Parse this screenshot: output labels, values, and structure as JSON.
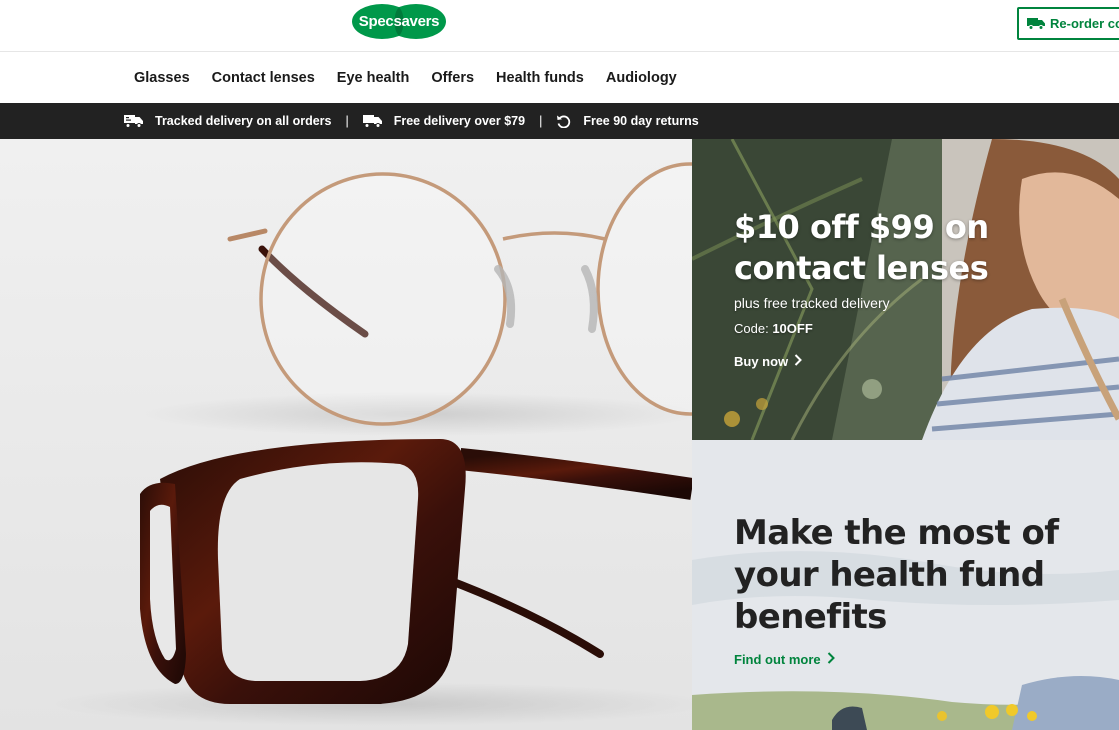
{
  "header": {
    "logo_text": "Specsavers",
    "reorder_label": "Re-order contacts"
  },
  "nav": {
    "items": [
      {
        "label": "Glasses"
      },
      {
        "label": "Contact lenses"
      },
      {
        "label": "Eye health"
      },
      {
        "label": "Offers"
      },
      {
        "label": "Health funds"
      },
      {
        "label": "Audiology"
      }
    ]
  },
  "usp": {
    "items": [
      {
        "label": "Tracked delivery on all orders",
        "icon": "delivery-truck-icon"
      },
      {
        "label": "Free delivery over $79",
        "icon": "truck-icon"
      },
      {
        "label": "Free 90 day returns",
        "icon": "return-arrow-icon"
      }
    ],
    "separator": "|"
  },
  "promo_contacts": {
    "title": "$10 off $99 on contact lenses",
    "subtitle": "plus free tracked delivery",
    "code_label": "Code:",
    "code_value": "10OFF",
    "cta": "Buy now"
  },
  "promo_health": {
    "title": "Make the most of your health fund benefits",
    "cta": "Find out more"
  },
  "colors": {
    "brand_green": "#00843d",
    "usp_bar": "#222222",
    "text_dark": "#222222"
  }
}
